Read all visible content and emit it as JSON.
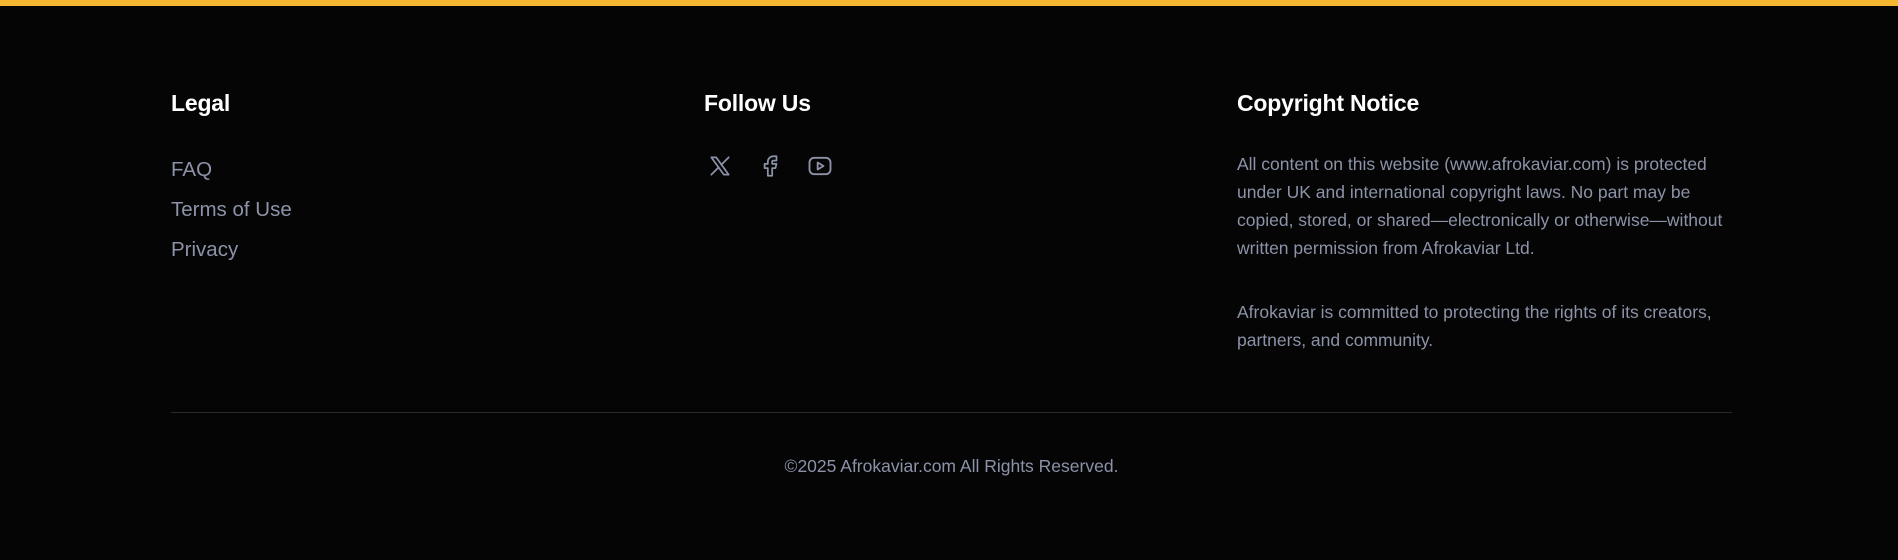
{
  "colors": {
    "accent_bar": "#f5b731",
    "background": "#050505",
    "heading": "#ffffff",
    "muted_text": "#8c93a8",
    "divider": "#262a30"
  },
  "legal": {
    "heading": "Legal",
    "links": [
      {
        "label": "FAQ"
      },
      {
        "label": "Terms of Use"
      },
      {
        "label": "Privacy"
      }
    ]
  },
  "follow": {
    "heading": "Follow Us",
    "icons": [
      "x-twitter-icon",
      "facebook-icon",
      "youtube-icon"
    ]
  },
  "copyright": {
    "heading": "Copyright Notice",
    "paragraph_1": "All content on this website (www.afrokaviar.com) is protected under UK and international copyright laws. No part may be copied, stored, or shared—electronically or otherwise—without written permission from Afrokaviar Ltd.",
    "paragraph_2": "Afrokaviar is committed to protecting the rights of its creators, partners, and community."
  },
  "bottom": {
    "text": "©2025 Afrokaviar.com All Rights Reserved."
  }
}
